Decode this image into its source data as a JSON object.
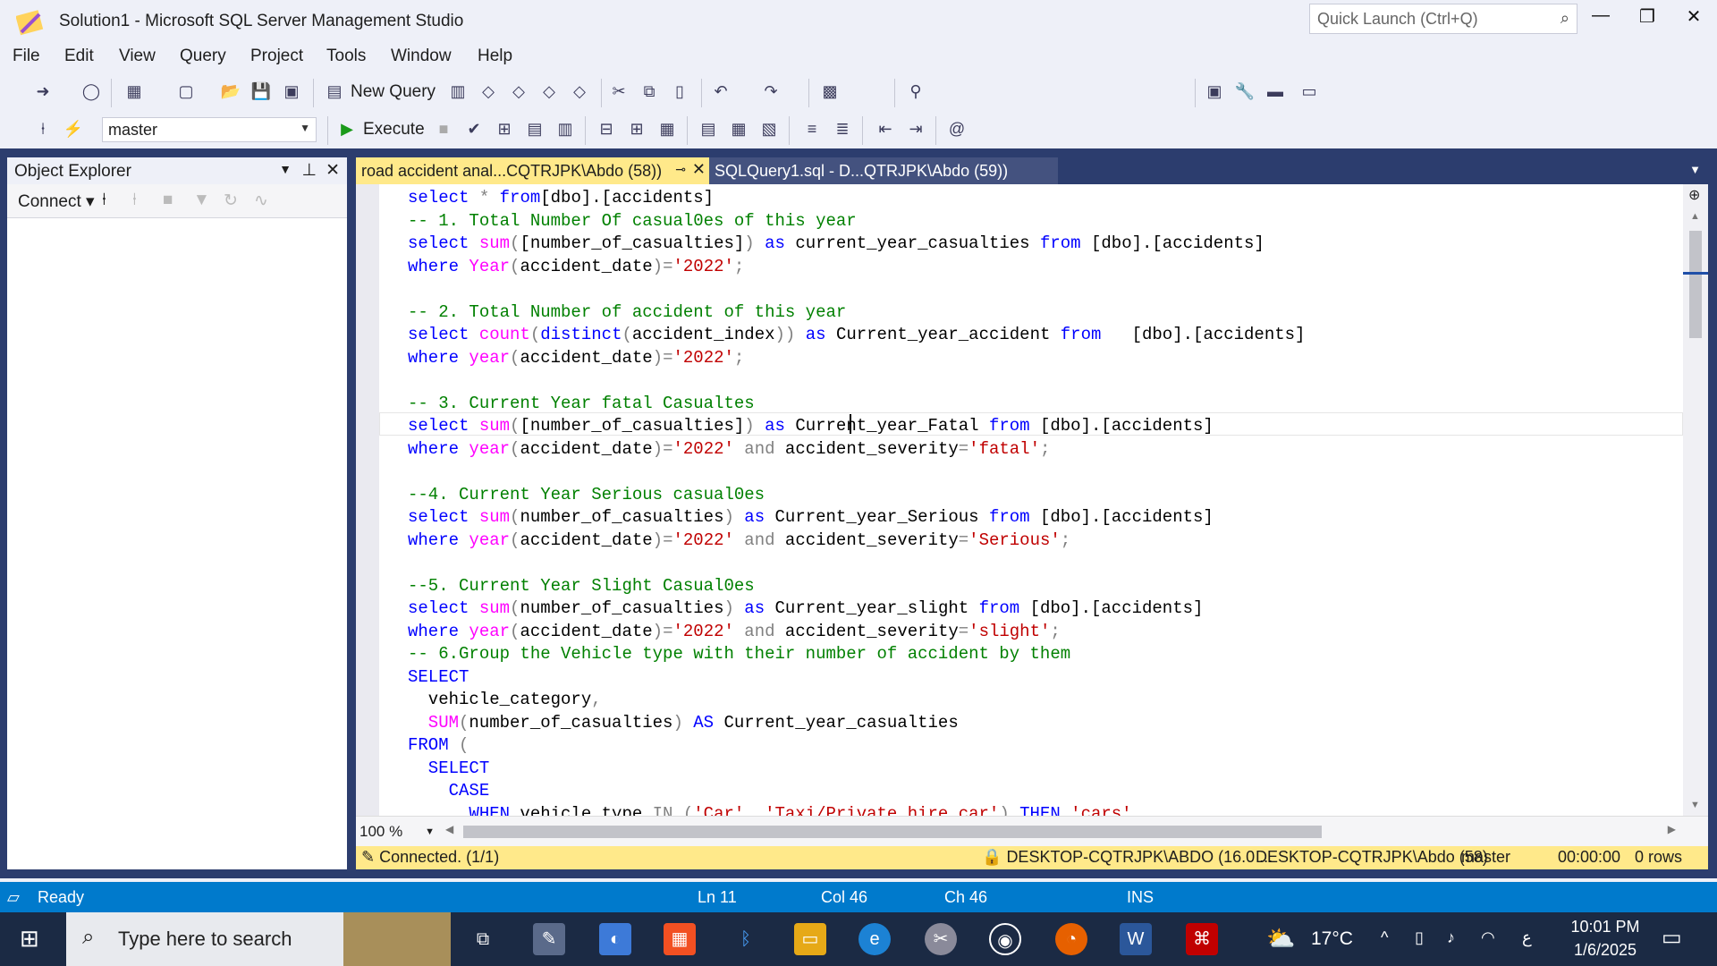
{
  "window": {
    "title": "Solution1 - Microsoft SQL Server Management Studio",
    "quick_launch_placeholder": "Quick Launch (Ctrl+Q)"
  },
  "menu": [
    "File",
    "Edit",
    "View",
    "Query",
    "Project",
    "Tools",
    "Window",
    "Help"
  ],
  "toolbar": {
    "new_query": "New Query",
    "execute": "Execute",
    "database": "master"
  },
  "object_explorer": {
    "title": "Object Explorer",
    "connect": "Connect"
  },
  "tabs": [
    {
      "label": "road accident anal...CQTRJPK\\Abdo (58))",
      "active": true
    },
    {
      "label": "SQLQuery1.sql - D...QTRJPK\\Abdo (59))",
      "active": false
    }
  ],
  "code_lines": [
    [
      [
        "kw",
        "select"
      ],
      [
        "op",
        " * "
      ],
      [
        "kw",
        "from"
      ],
      [
        "",
        "[dbo].[accidents]"
      ]
    ],
    [
      [
        "cmt",
        "-- 1. Total Number Of casual0es of this year"
      ]
    ],
    [
      [
        "kw",
        "select "
      ],
      [
        "fn",
        "sum"
      ],
      [
        "op",
        "("
      ],
      [
        "",
        "[number_of_casualties]"
      ],
      [
        "op",
        ")"
      ],
      [
        "kw",
        " as "
      ],
      [
        "",
        "current_year_casualties "
      ],
      [
        "kw",
        "from "
      ],
      [
        "",
        "[dbo].[accidents]"
      ]
    ],
    [
      [
        "kw",
        "where "
      ],
      [
        "fn",
        "Year"
      ],
      [
        "op",
        "("
      ],
      [
        "",
        "accident_date"
      ],
      [
        "op",
        ")="
      ],
      [
        "str",
        "'2022'"
      ],
      [
        "op",
        ";"
      ]
    ],
    [],
    [
      [
        "cmt",
        "-- 2. Total Number of accident of this year"
      ]
    ],
    [
      [
        "kw",
        "select "
      ],
      [
        "fn",
        "count"
      ],
      [
        "op",
        "("
      ],
      [
        "kw",
        "distinct"
      ],
      [
        "op",
        "("
      ],
      [
        "",
        "accident_index"
      ],
      [
        "op",
        "))"
      ],
      [
        "kw",
        " as "
      ],
      [
        "",
        "Current_year_accident "
      ],
      [
        "kw",
        "from "
      ],
      [
        "",
        "  [dbo].[accidents]"
      ]
    ],
    [
      [
        "kw",
        "where "
      ],
      [
        "fn",
        "year"
      ],
      [
        "op",
        "("
      ],
      [
        "",
        "accident_date"
      ],
      [
        "op",
        ")="
      ],
      [
        "str",
        "'2022'"
      ],
      [
        "op",
        ";"
      ]
    ],
    [],
    [
      [
        "cmt",
        "-- 3. Current Year fatal Casualtes"
      ]
    ],
    [
      [
        "kw",
        "select "
      ],
      [
        "fn",
        "sum"
      ],
      [
        "op",
        "("
      ],
      [
        "",
        "[number_of_casualties]"
      ],
      [
        "op",
        ")"
      ],
      [
        "kw",
        " as "
      ],
      [
        "",
        "Current_year_Fatal "
      ],
      [
        "kw",
        "from "
      ],
      [
        "",
        "[dbo].[accidents]"
      ]
    ],
    [
      [
        "kw",
        "where "
      ],
      [
        "fn",
        "year"
      ],
      [
        "op",
        "("
      ],
      [
        "",
        "accident_date"
      ],
      [
        "op",
        ")="
      ],
      [
        "str",
        "'2022'"
      ],
      [
        "op",
        " and "
      ],
      [
        "",
        "accident_severity"
      ],
      [
        "op",
        "="
      ],
      [
        "str",
        "'fatal'"
      ],
      [
        "op",
        ";"
      ]
    ],
    [],
    [
      [
        "cmt",
        "--4. Current Year Serious casual0es"
      ]
    ],
    [
      [
        "kw",
        "select "
      ],
      [
        "fn",
        "sum"
      ],
      [
        "op",
        "("
      ],
      [
        "",
        "number_of_casualties"
      ],
      [
        "op",
        ")"
      ],
      [
        "kw",
        " as "
      ],
      [
        "",
        "Current_year_Serious "
      ],
      [
        "kw",
        "from "
      ],
      [
        "",
        "[dbo].[accidents]"
      ]
    ],
    [
      [
        "kw",
        "where "
      ],
      [
        "fn",
        "year"
      ],
      [
        "op",
        "("
      ],
      [
        "",
        "accident_date"
      ],
      [
        "op",
        ")="
      ],
      [
        "str",
        "'2022'"
      ],
      [
        "op",
        " and "
      ],
      [
        "",
        "accident_severity"
      ],
      [
        "op",
        "="
      ],
      [
        "str",
        "'Serious'"
      ],
      [
        "op",
        ";"
      ]
    ],
    [],
    [
      [
        "cmt",
        "--5. Current Year Slight Casual0es"
      ]
    ],
    [
      [
        "kw",
        "select "
      ],
      [
        "fn",
        "sum"
      ],
      [
        "op",
        "("
      ],
      [
        "",
        "number_of_casualties"
      ],
      [
        "op",
        ")"
      ],
      [
        "kw",
        " as "
      ],
      [
        "",
        "Current_year_slight "
      ],
      [
        "kw",
        "from "
      ],
      [
        "",
        "[dbo].[accidents]"
      ]
    ],
    [
      [
        "kw",
        "where "
      ],
      [
        "fn",
        "year"
      ],
      [
        "op",
        "("
      ],
      [
        "",
        "accident_date"
      ],
      [
        "op",
        ")="
      ],
      [
        "str",
        "'2022'"
      ],
      [
        "op",
        " and "
      ],
      [
        "",
        "accident_severity"
      ],
      [
        "op",
        "="
      ],
      [
        "str",
        "'slight'"
      ],
      [
        "op",
        ";"
      ]
    ],
    [
      [
        "cmt",
        "-- 6.Group the Vehicle type with their number of accident by them"
      ]
    ],
    [
      [
        "kw",
        "SELECT"
      ]
    ],
    [
      [
        "",
        "  vehicle_category"
      ],
      [
        "op",
        ","
      ]
    ],
    [
      [
        "fn",
        "  SUM"
      ],
      [
        "op",
        "("
      ],
      [
        "",
        "number_of_casualties"
      ],
      [
        "op",
        ")"
      ],
      [
        "kw",
        " AS "
      ],
      [
        "",
        "Current_year_casualties"
      ]
    ],
    [
      [
        "kw",
        "FROM "
      ],
      [
        "op",
        "("
      ]
    ],
    [
      [
        "kw",
        "  SELECT"
      ]
    ],
    [
      [
        "kw",
        "    CASE"
      ]
    ],
    [
      [
        "kw",
        "      WHEN "
      ],
      [
        "",
        "vehicle_type "
      ],
      [
        "op",
        "IN ("
      ],
      [
        "str",
        "'Car'"
      ],
      [
        "op",
        ", "
      ],
      [
        "str",
        "'Taxi/Private hire car'"
      ],
      [
        "op",
        ") "
      ],
      [
        "kw",
        "THEN "
      ],
      [
        "str",
        "'cars'"
      ]
    ]
  ],
  "editor": {
    "zoom": "100 %"
  },
  "query_status": {
    "connected": "Connected. (1/1)",
    "server": "DESKTOP-CQTRJPK\\ABDO (16.0 ...",
    "user": "DESKTOP-CQTRJPK\\Abdo (58)",
    "db": "master",
    "time": "00:00:00",
    "rows": "0 rows"
  },
  "status": {
    "ready": "Ready",
    "ln": "Ln 11",
    "col": "Col 46",
    "ch": "Ch 46",
    "ins": "INS"
  },
  "taskbar": {
    "search": "Type here to search",
    "temp": "17°C",
    "time": "10:01 PM",
    "date": "1/6/2025",
    "lang": "ع"
  }
}
